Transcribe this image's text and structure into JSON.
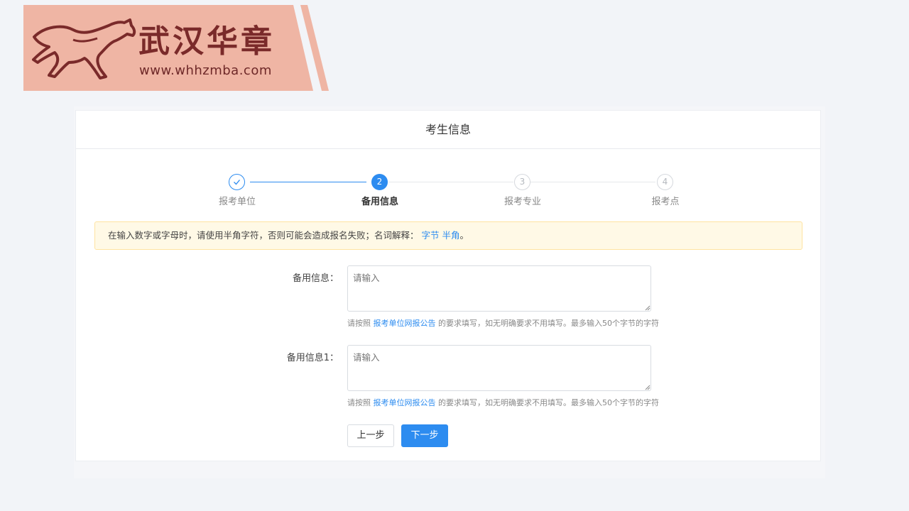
{
  "brand": {
    "title": "武汉华章",
    "url": "www.whhzmba.com",
    "colors": {
      "banner_bg": "#efb5a4",
      "text": "#7a2a2a"
    },
    "logo_icon": "running-horse-icon"
  },
  "card": {
    "title": "考生信息"
  },
  "steps": [
    {
      "index": "1",
      "label": "报考单位",
      "status": "done",
      "icon": "check-icon"
    },
    {
      "index": "2",
      "label": "备用信息",
      "status": "active"
    },
    {
      "index": "3",
      "label": "报考专业",
      "status": "wait"
    },
    {
      "index": "4",
      "label": "报考点",
      "status": "wait"
    }
  ],
  "notice": {
    "text": "在输入数字或字母时，请使用半角字符，否则可能会造成报名失败；名词解释：",
    "link1": "字节",
    "link2": "半角",
    "suffix": "。"
  },
  "fields": [
    {
      "label": "备用信息：",
      "placeholder": "请输入",
      "hint_prefix": "请按照",
      "hint_link": "报考单位网报公告",
      "hint_suffix": "的要求填写，如无明确要求不用填写。最多输入50个字节的字符"
    },
    {
      "label": "备用信息1：",
      "placeholder": "请输入",
      "hint_prefix": "请按照",
      "hint_link": "报考单位网报公告",
      "hint_suffix": "的要求填写，如无明确要求不用填写。最多输入50个字节的字符"
    }
  ],
  "buttons": {
    "prev": "上一步",
    "next": "下一步"
  },
  "colors": {
    "primary": "#2d8cf0",
    "notice_bg": "#fff9e6",
    "notice_border": "#ffe3a1"
  }
}
